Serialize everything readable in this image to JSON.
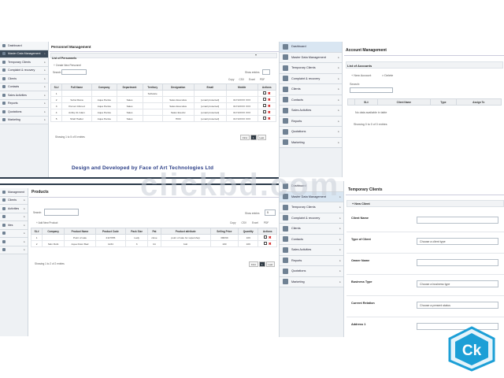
{
  "brand": {
    "accent": "#2b3a4a",
    "danger": "#d32020"
  },
  "tl": {
    "sidebar": [
      "Dashboard",
      "Master Data Management",
      "Temporary Clients",
      "Complaint & recovery",
      "Clients",
      "Contacts",
      "Sales Activities",
      "Reports",
      "Quotations",
      "Marketing"
    ],
    "title": "Personnel Management",
    "list_title": "List of Personnels",
    "add": "+ Create New Personnel",
    "search_label": "Search:",
    "show": "Show entries",
    "tools": [
      "Copy",
      "CSV",
      "Excel",
      "PDF"
    ],
    "columns": [
      "SL#",
      "Full Name",
      "Company",
      "Department",
      "Territory",
      "Designation",
      "Email",
      "Mobile",
      "Actions"
    ],
    "rows": [
      [
        "1",
        "",
        "",
        "",
        "Software",
        "",
        "",
        "",
        ""
      ],
      [
        "2",
        "Sohel Rana",
        "Aqua Pentia",
        "Sales",
        "",
        "Sales Executive",
        "[email protected]",
        "01713XXX XXX",
        ""
      ],
      [
        "3",
        "Pervez Ahmed",
        "Aqua Pentia",
        "Sales",
        "",
        "Sales Executive",
        "[email protected]",
        "01713XXX XXX",
        ""
      ],
      [
        "4",
        "Ashiq UL Islam",
        "Aqua Pentia",
        "Sales",
        "",
        "Sales Exectiv",
        "[email protected]",
        "01713XXX XXX",
        ""
      ],
      [
        "5",
        "Shafi Haider",
        "Aqua Pentia",
        "Sales",
        "",
        "HOD",
        "[email protected]",
        "01713XXX XXX",
        ""
      ]
    ],
    "footer": "Showing 1 to 5 of 5 entries",
    "pager": [
      "First",
      "1",
      "Last"
    ],
    "credit": "Design and Developed by Face of Art Technologies Ltd"
  },
  "tr": {
    "sidebar": [
      "Dashboard",
      "Master Data Management",
      "Temporary Clients",
      "Complaint & recovery",
      "Clients",
      "Contacts",
      "Sales Activities",
      "Reports",
      "Quotations",
      "Marketing"
    ],
    "title": "Account Management",
    "list_title": "List of Accounts",
    "add": "+ New Account",
    "delete": "× Delete",
    "search_label": "Search:",
    "columns": [
      "",
      "SL#",
      "Client Name",
      "Type",
      "Assign To"
    ],
    "empty": "No data available in table",
    "footer": "Showing 0 to 0 of 0 entries"
  },
  "bl": {
    "sidebar": [
      "Management",
      "Clients",
      "Activities",
      "",
      "ities",
      "",
      "",
      ""
    ],
    "title": "Products",
    "search_label": "Search:",
    "show": "Show entries",
    "show_value": "5",
    "add": "+ Add New Product",
    "tools": [
      "Copy",
      "CSV",
      "Excel",
      "PDF"
    ],
    "columns": [
      "SL#",
      "Company",
      "Product Name",
      "Product Code",
      "Pack Size",
      "Pat",
      "Product attribute",
      "Selling Price",
      "Quantity",
      "Actions"
    ],
    "rows": [
      [
        "1",
        "",
        "Point of sale",
        "2117655",
        "Lady",
        "close",
        "point of sale for supershop",
        "390/99",
        "109",
        ""
      ],
      [
        "2",
        "Skin Robt",
        "Aqua Dolor Bad",
        "1234",
        "3",
        "bit",
        "bob",
        "100",
        "109",
        ""
      ]
    ],
    "footer": "Showing 1 to 2 of 2 entries",
    "pager": [
      "First",
      "1",
      "Last"
    ]
  },
  "br": {
    "sidebar": [
      "Dashboard",
      "Master Data Management",
      "Temporary Clients",
      "Complaint & recovery",
      "Clients",
      "Contacts",
      "Sales Activities",
      "Reports",
      "Quotations",
      "Marketing"
    ],
    "title": "Temporary Clients",
    "new": "+ New Client",
    "fields": [
      {
        "label": "Client Name",
        "value": ""
      },
      {
        "label": "Type of Client",
        "value": "Choose a client type"
      },
      {
        "label": "Owner Name",
        "value": ""
      },
      {
        "label": "Business Type",
        "value": "Choose a business type"
      },
      {
        "label": "Current Relation",
        "value": "Choose a present status"
      },
      {
        "label": "Address 1",
        "value": ""
      }
    ]
  },
  "watermark": "clickbd.com"
}
